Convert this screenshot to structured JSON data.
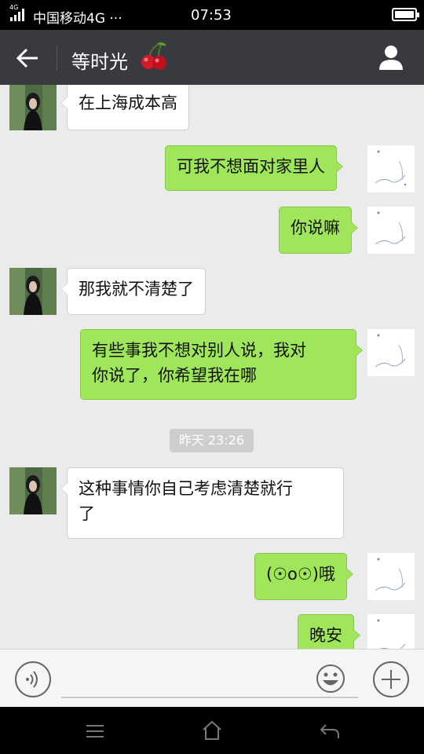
{
  "status_bar": {
    "network_small": "4G",
    "carrier": "中国移动4G ···",
    "time": "07:53"
  },
  "header": {
    "title": "等时光",
    "back_icon": "arrow-left-icon",
    "profile_icon": "person-icon",
    "title_emoji": "cherry-icon"
  },
  "messages": [
    {
      "side": "in",
      "text": "在上海成本高"
    },
    {
      "side": "out",
      "text": "可我不想面对家里人"
    },
    {
      "side": "out",
      "text": "你说嘛"
    },
    {
      "side": "in",
      "text": "那我就不清楚了"
    },
    {
      "side": "out",
      "line1": "有些事我不想对别人说，我对",
      "line2": "你说了，你希望我在哪"
    },
    {
      "side": "in",
      "line1": "这种事情你自己考虑清楚就行",
      "line2": "了"
    },
    {
      "side": "out",
      "text": "(☉o☉)哦"
    },
    {
      "side": "out",
      "text": "晚安"
    }
  ],
  "timestamp": "昨天 23:26",
  "input_bar": {
    "voice_icon": "voice-icon",
    "emoji_icon": "smiley-icon",
    "plus_icon": "plus-icon"
  },
  "colors": {
    "titlebar": "#393a3f",
    "outgoing_bubble": "#9fe65a",
    "incoming_bubble": "#ffffff",
    "chat_background": "#ebebeb"
  }
}
